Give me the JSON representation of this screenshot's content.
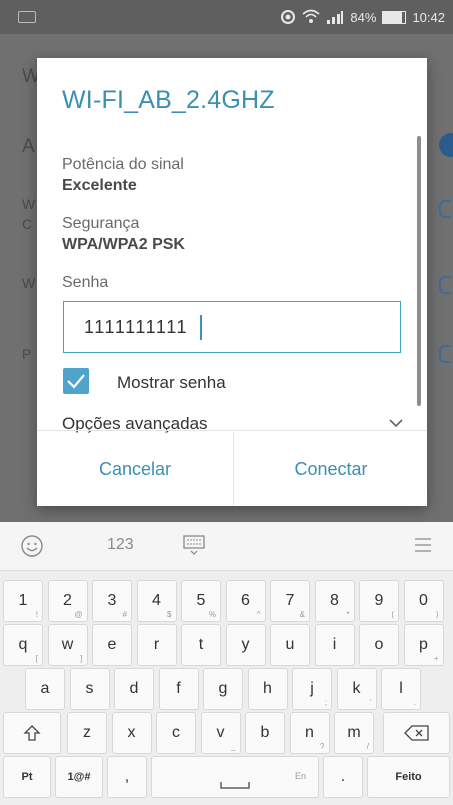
{
  "status_bar": {
    "battery": "84%",
    "time": "10:42",
    "battery_level": 0.84
  },
  "background": {
    "peek_chars": [
      "W",
      "A",
      "W",
      "C",
      "W",
      "P"
    ]
  },
  "dialog": {
    "title": "WI-FI_AB_2.4GHZ",
    "signal_label": "Potência do sinal",
    "signal_value": "Excelente",
    "security_label": "Segurança",
    "security_value": "WPA/WPA2 PSK",
    "password_label": "Senha",
    "password_value": "1111111111",
    "show_password_label": "Mostrar senha",
    "show_password_checked": true,
    "advanced_label": "Opções avançadas",
    "cancel_label": "Cancelar",
    "connect_label": "Conectar"
  },
  "keyboard": {
    "mode_label": "123",
    "row1": [
      [
        "1",
        "!"
      ],
      [
        "2",
        "@"
      ],
      [
        "3",
        "#"
      ],
      [
        "4",
        "$"
      ],
      [
        "5",
        "%"
      ],
      [
        "6",
        "^"
      ],
      [
        "7",
        "&"
      ],
      [
        "8",
        "*"
      ],
      [
        "9",
        "("
      ],
      [
        "0",
        ")"
      ]
    ],
    "row2": [
      [
        "q",
        "["
      ],
      [
        "w",
        "]"
      ],
      [
        "e",
        ""
      ],
      [
        "r",
        ""
      ],
      [
        "t",
        ""
      ],
      [
        "y",
        ""
      ],
      [
        "u",
        ""
      ],
      [
        "i",
        ""
      ],
      [
        "o",
        ""
      ],
      [
        "p",
        "+"
      ]
    ],
    "row3": [
      [
        "a",
        ""
      ],
      [
        "s",
        ""
      ],
      [
        "d",
        ""
      ],
      [
        "f",
        ""
      ],
      [
        "g",
        ""
      ],
      [
        "h",
        ""
      ],
      [
        "j",
        ";"
      ],
      [
        "k",
        "'"
      ],
      [
        "l",
        "."
      ]
    ],
    "row4": [
      [
        "z",
        ""
      ],
      [
        "x",
        ""
      ],
      [
        "c",
        ""
      ],
      [
        "v",
        "_"
      ],
      [
        "b",
        ""
      ],
      [
        "n",
        "?"
      ],
      [
        "m",
        "/"
      ]
    ],
    "lang_label": "Pt",
    "symbols_label": "1@#",
    "comma": ",",
    "space_hint": "En",
    "period": ".",
    "done_label": "Feito"
  }
}
